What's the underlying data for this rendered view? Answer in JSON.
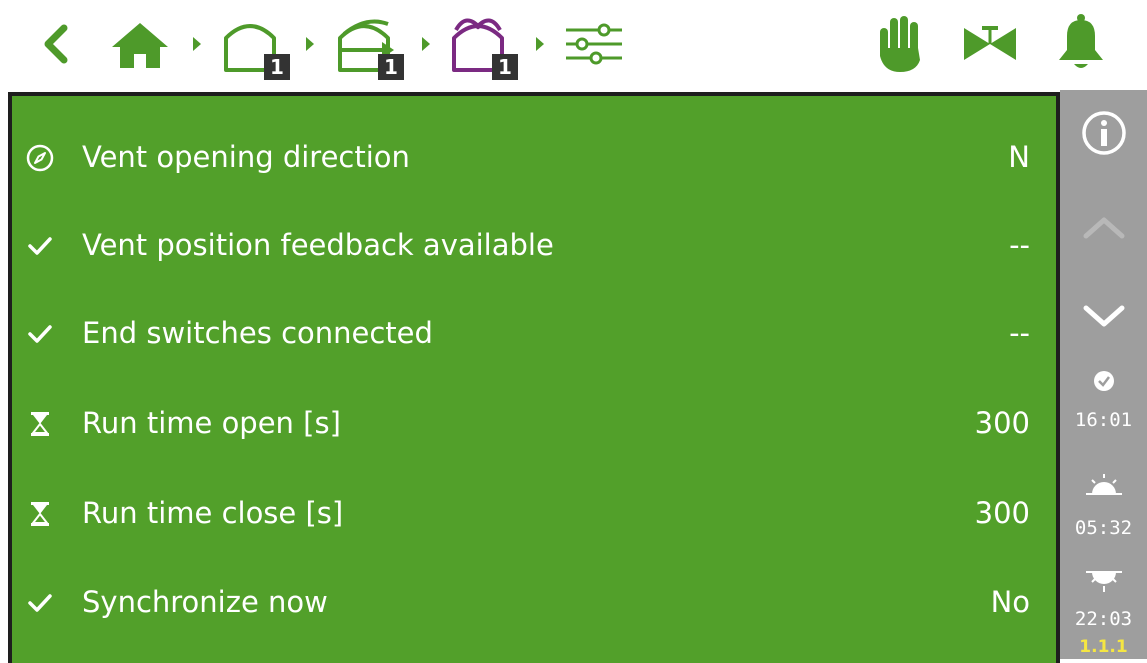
{
  "breadcrumb": {
    "level1_badge": "1",
    "level2_badge": "1",
    "level3_badge": "1"
  },
  "colors": {
    "accent": "#4e9a2a",
    "panel": "#52a02a",
    "sidebar": "#9e9e9e",
    "vent_purple": "#7b2a82",
    "version": "#f5e642"
  },
  "settings": {
    "rows": [
      {
        "icon": "compass-icon",
        "label": "Vent opening direction",
        "value": "N"
      },
      {
        "icon": "check-icon",
        "label": "Vent position feedback available",
        "value": "--"
      },
      {
        "icon": "check-icon",
        "label": "End switches connected",
        "value": "--"
      },
      {
        "icon": "hourglass-icon",
        "label": "Run time open [s]",
        "value": "300"
      },
      {
        "icon": "hourglass-icon",
        "label": "Run time close [s]",
        "value": "300"
      },
      {
        "icon": "check-icon",
        "label": "Synchronize now",
        "value": "No"
      }
    ]
  },
  "sidebar": {
    "clock_time": "16:01",
    "sunrise_time": "05:32",
    "sunset_time": "22:03",
    "version": "1.1.1"
  }
}
